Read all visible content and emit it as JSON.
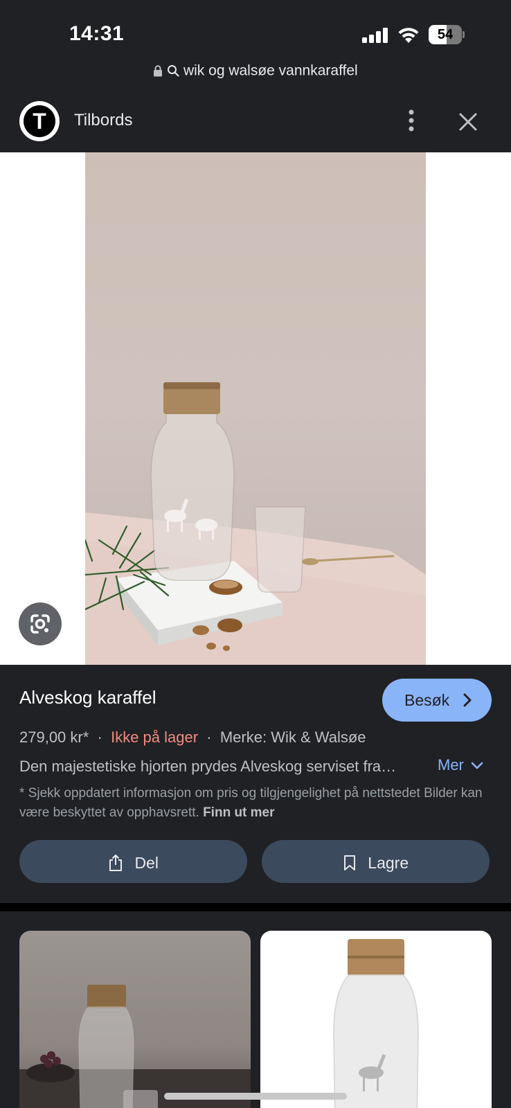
{
  "status_bar": {
    "time": "14:31",
    "battery_percent": "54",
    "battery_level": 0.54
  },
  "url_bar": {
    "query": "wik og walsøe vannkaraffel"
  },
  "site": {
    "logo_letter": "T",
    "name": "Tilbords"
  },
  "product": {
    "title": "Alveskog karaffel",
    "visit_label": "Besøk",
    "price": "279,00 kr*",
    "stock_status": "Ikke på lager",
    "brand": "Merke: Wik & Walsøe",
    "description": "Den majestetiske hjorten prydes Alveskog serviset fra…",
    "more_label": "Mer",
    "disclaimer": "* Sjekk oppdatert informasjon om pris og tilgjengelighet på nettstedet Bilder kan være beskyttet av opphavsrett.",
    "learn_more": "Finn ut mer",
    "share_label": "Del",
    "save_label": "Lagre"
  },
  "icons": {
    "lock": "lock-icon",
    "search": "search-icon",
    "more": "more-vert-icon",
    "close": "close-icon",
    "lens": "google-lens-icon",
    "share": "share-icon",
    "bookmark": "bookmark-icon",
    "chevron_right": "chevron-right-icon",
    "chevron_down": "chevron-down-icon"
  },
  "colors": {
    "background": "#202124",
    "accent": "#8ab4f8",
    "out_of_stock": "#f28b82",
    "action_button": "#3c4a5e"
  }
}
